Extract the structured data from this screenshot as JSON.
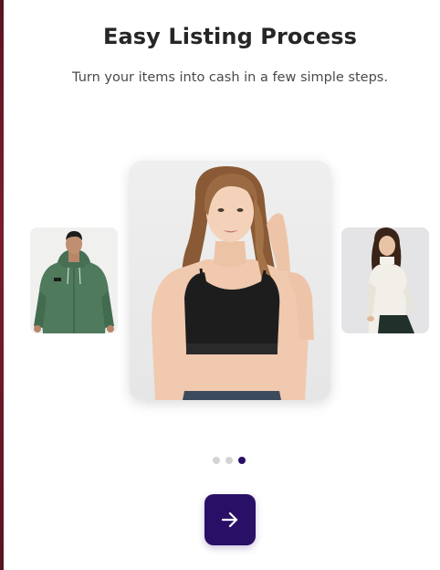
{
  "header": {
    "title": "Easy Listing Process",
    "subtitle": "Turn your items into cash in a few simple steps."
  },
  "carousel": {
    "slides": [
      {
        "description": "Man in green hooded zip jacket",
        "position": "previous"
      },
      {
        "description": "Woman in black crop top",
        "position": "current"
      },
      {
        "description": "Woman in white turtleneck",
        "position": "next"
      }
    ],
    "pagination": {
      "total": 3,
      "active_index": 2
    }
  },
  "next_button": {
    "icon": "arrow-right-icon"
  },
  "colors": {
    "accent": "#2a0f67",
    "title": "#262626",
    "subtitle": "#4a4a4a",
    "dot_inactive": "#d4d4d4"
  }
}
